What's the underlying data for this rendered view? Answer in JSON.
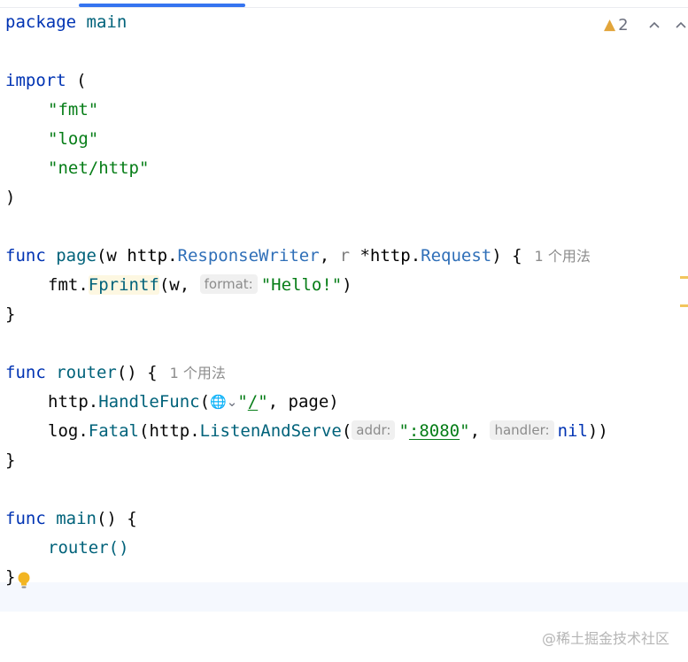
{
  "toolbar": {
    "warning_count": "2",
    "warning_icon": "warning-triangle-icon",
    "prev_icon": "chevron-up-icon",
    "next_icon": "chevron-up-icon"
  },
  "code": {
    "l1": {
      "kw": "package",
      "name": "main"
    },
    "l3": {
      "kw": "import",
      "paren": "("
    },
    "l4": "\"fmt\"",
    "l5": "\"log\"",
    "l6": "\"net/http\"",
    "l7": ")",
    "l9": {
      "kw": "func",
      "name": "page",
      "open": "(w ",
      "pkg1": "http",
      "dot1": ".",
      "type1": "ResponseWriter",
      "mid": ", ",
      "r": "r",
      "star": " *",
      "pkg2": "http",
      "dot2": ".",
      "type2": "Request",
      "close": ") {",
      "usage": "1 个用法"
    },
    "l10": {
      "pkg": "fmt",
      "dot": ".",
      "fn": "Fprintf",
      "open": "(w, ",
      "hint": "format:",
      "str": "\"Hello!\"",
      "close": ")"
    },
    "l11": "}",
    "l13": {
      "kw": "func",
      "name": "router",
      "rest": "() {",
      "usage": "1 个用法"
    },
    "l14": {
      "pkg": "http",
      "dot": ".",
      "fn": "HandleFunc",
      "open": "(",
      "globe": "🌐⌄",
      "q1": "\"",
      "path": "/",
      "q2": "\"",
      "rest": ", page)"
    },
    "l15": {
      "pkg": "log",
      "dot": ".",
      "fn": "Fatal",
      "open": "(",
      "pkg2": "http",
      "dot2": ".",
      "fn2": "ListenAndServe",
      "open2": "(",
      "hint1": "addr:",
      "q1": "\"",
      "addr": ":8080",
      "q2": "\"",
      "comma": ", ",
      "hint2": "handler:",
      "nil": "nil",
      "close": "))"
    },
    "l16": "}",
    "l18": {
      "kw": "func",
      "name": "main",
      "rest": "() {"
    },
    "l19": "router()",
    "l20": "}"
  },
  "watermark": "@稀土掘金技术社区",
  "colors": {
    "accent": "#3574f0",
    "keyword": "#0033b3",
    "string": "#067d17",
    "function": "#00627a",
    "marker": "#f2c55c"
  }
}
